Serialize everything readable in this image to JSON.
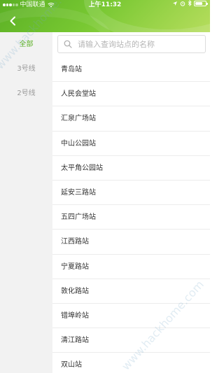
{
  "status_bar": {
    "carrier": "中国联通",
    "time": "上午11:32",
    "battery_level": 0.7
  },
  "header": {
    "back_icon": "chevron-left-icon"
  },
  "sidebar": {
    "items": [
      {
        "label": "全部",
        "active": true
      },
      {
        "label": "3号线",
        "active": false
      },
      {
        "label": "2号线",
        "active": false
      }
    ]
  },
  "search": {
    "placeholder": "请输入查询站点的名称",
    "value": ""
  },
  "stations": [
    "青岛站",
    "人民会堂站",
    "汇泉广场站",
    "中山公园站",
    "太平角公园站",
    "延安三路站",
    "五四广场站",
    "江西路站",
    "宁夏路站",
    "敦化路站",
    "错埠岭站",
    "清江路站",
    "双山站"
  ],
  "watermark": "www.hackhome.com",
  "colors": {
    "accent": "#5bb025",
    "sidebar_bg": "#f2f2f2",
    "divider": "#ececec"
  }
}
